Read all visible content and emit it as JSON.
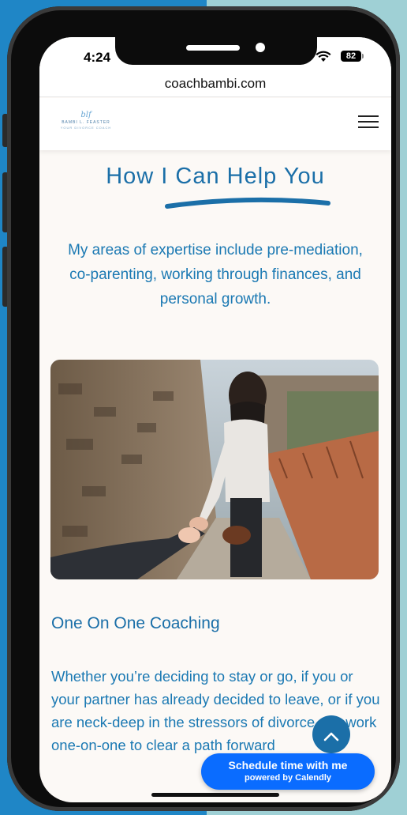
{
  "status_bar": {
    "time": "4:24",
    "battery": "82"
  },
  "browser": {
    "url": "coachbambi.com"
  },
  "site": {
    "logo": {
      "mark": "blf",
      "name": "BAMBI L. FEASTER",
      "tagline": "YOUR DIVORCE COACH"
    }
  },
  "section": {
    "title": "How I Can Help You",
    "intro": "My areas of expertise include pre-mediation, co-parenting, working through finances, and personal growth.",
    "subheading": "One On One Coaching",
    "body": "Whether you’re deciding  to stay or go, if you or your partner has already decided to leave, or if you are neck-deep in the stressors of divorce, we work one-on-one to clear a path forward"
  },
  "calendly": {
    "label": "Schedule time with me",
    "sub": "powered by Calendly"
  },
  "colors": {
    "accent": "#1b6fa8",
    "text": "#1b79b3",
    "page_bg": "#fcf9f6",
    "calendly": "#0a6cff"
  },
  "icons": [
    "menu-icon",
    "wifi-icon",
    "battery-icon",
    "chevron-up-icon"
  ]
}
